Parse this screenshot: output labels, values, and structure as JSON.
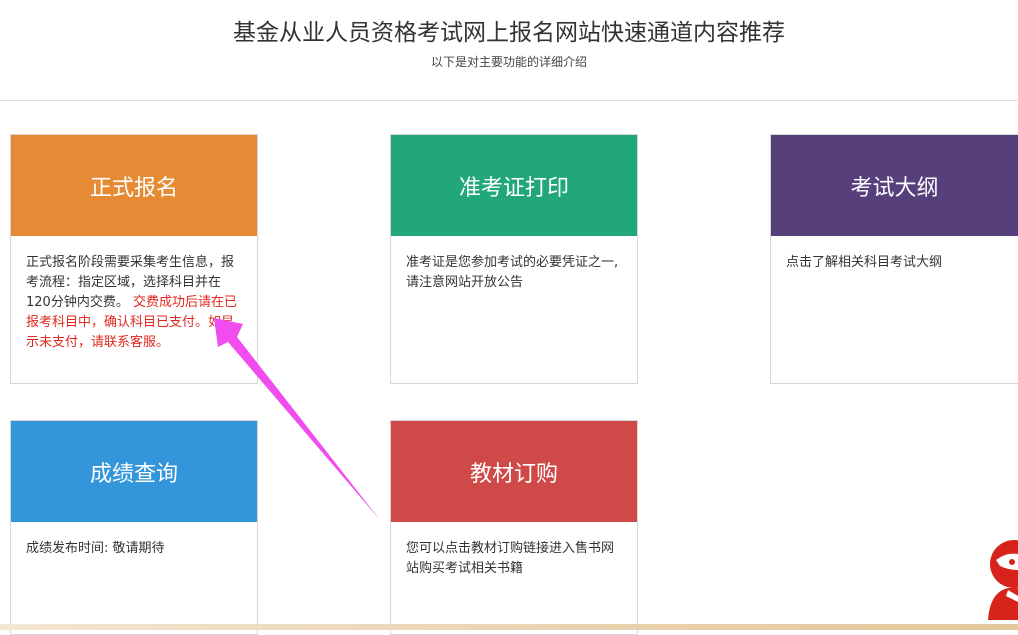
{
  "header": {
    "title": "基金从业人员资格考试网上报名网站快速通道内容推荐",
    "subtitle": "以下是对主要功能的详细介绍"
  },
  "cards": [
    {
      "title": "正式报名",
      "color": "#e68a35",
      "desc": "正式报名阶段需要采集考生信息，报考流程：指定区域，选择科目并在120分钟内交费。",
      "highlight": " 交费成功后请在已报考科目中，确认科目已支付。如显示未支付，请联系客服。",
      "highlight_color": "#e0281e"
    },
    {
      "title": "准考证打印",
      "color": "#21a77b",
      "desc": "准考证是您参加考试的必要凭证之一,请注意网站开放公告"
    },
    {
      "title": "考试大纲",
      "color": "#573f7c",
      "desc": "点击了解相关科目考试大纲"
    },
    {
      "title": "成绩查询",
      "color": "#3396da",
      "desc": "成绩发布时间: 敬请期待"
    },
    {
      "title": "教材订购",
      "color": "#cf4948",
      "desc": "您可以点击教材订购链接进入售书网站购买考试相关书籍"
    }
  ],
  "annotation": {
    "arrow_color": "#f04cf0"
  },
  "service_widget": {
    "icon": "customer-service-icon",
    "color": "#d8231c"
  }
}
